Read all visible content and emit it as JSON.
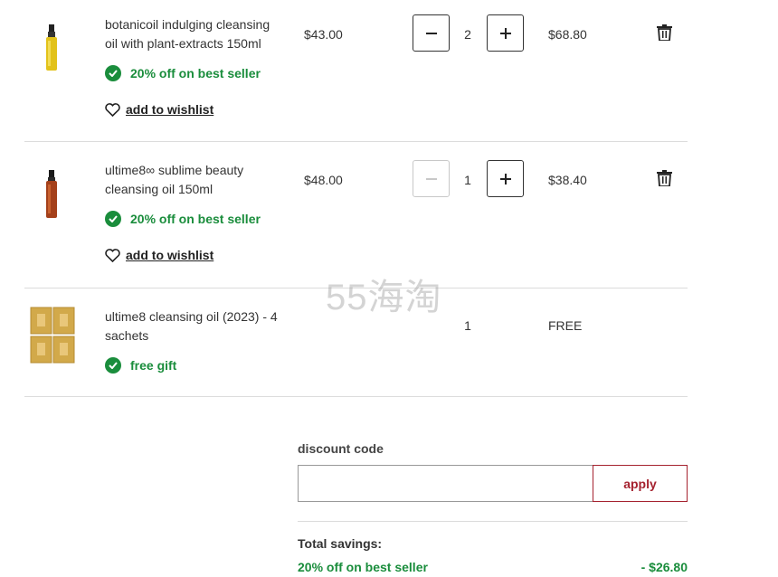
{
  "items": [
    {
      "name": "botanicoil indulging cleansing oil with plant-extracts 150ml",
      "price": "$43.00",
      "quantity": "2",
      "total": "$68.80",
      "promo": "20% off on best seller",
      "wishlist_label": "add to wishlist",
      "decrease_enabled": true
    },
    {
      "name": "ultime8∞ sublime beauty cleansing oil 150ml",
      "price": "$48.00",
      "quantity": "1",
      "total": "$38.40",
      "promo": "20% off on best seller",
      "wishlist_label": "add to wishlist",
      "decrease_enabled": false
    },
    {
      "name": "ultime8 cleansing oil (2023) - 4 sachets",
      "quantity": "1",
      "total": "FREE",
      "promo": "free gift"
    }
  ],
  "watermark": "55海淘",
  "discount": {
    "label": "discount code",
    "placeholder": "",
    "apply_label": "apply"
  },
  "summary": {
    "savings_title": "Total savings:",
    "savings_label": "20% off on best seller",
    "savings_value": "- $26.80"
  },
  "colors": {
    "promo_green": "#1a8d3c",
    "accent_red": "#a5222f"
  }
}
